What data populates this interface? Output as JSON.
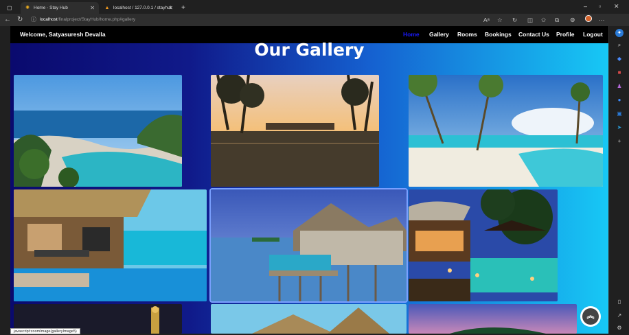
{
  "browser": {
    "tabs": [
      {
        "title": "Home - Stay Hub",
        "icon": "sun-icon"
      },
      {
        "title": "localhost / 127.0.0.1 / stayhub / ",
        "icon": "phpmyadmin-icon"
      }
    ],
    "new_tab": "+",
    "url_host": "localhost",
    "url_path": "/finalproject/StayHub/home.php#gallery",
    "status_text": "javascript:zoomImage(galleryImage5)"
  },
  "site": {
    "welcome": "Welcome, Satyasuresh Devalla",
    "nav": [
      "Home",
      "Gallery",
      "Rooms",
      "Bookings",
      "Contact Us",
      "Profile",
      "Logout"
    ],
    "active_nav": "Home",
    "gallery_title": "Our Gallery",
    "accent_color": "#1a1aff"
  },
  "gallery": {
    "images": [
      "resort infinity pool by the sea",
      "palm trees reflected in pool at sunset",
      "beach with swings and pool",
      "overwater bungalow deck",
      "overwater villa with pool",
      "resort pool at dusk",
      "night resort",
      "thatched roof villa",
      "island at sunset"
    ]
  },
  "icons": {
    "back": "back-arrow-icon",
    "refresh": "refresh-icon",
    "info": "info-icon",
    "scroll_top": "chevron-double-up-icon"
  }
}
